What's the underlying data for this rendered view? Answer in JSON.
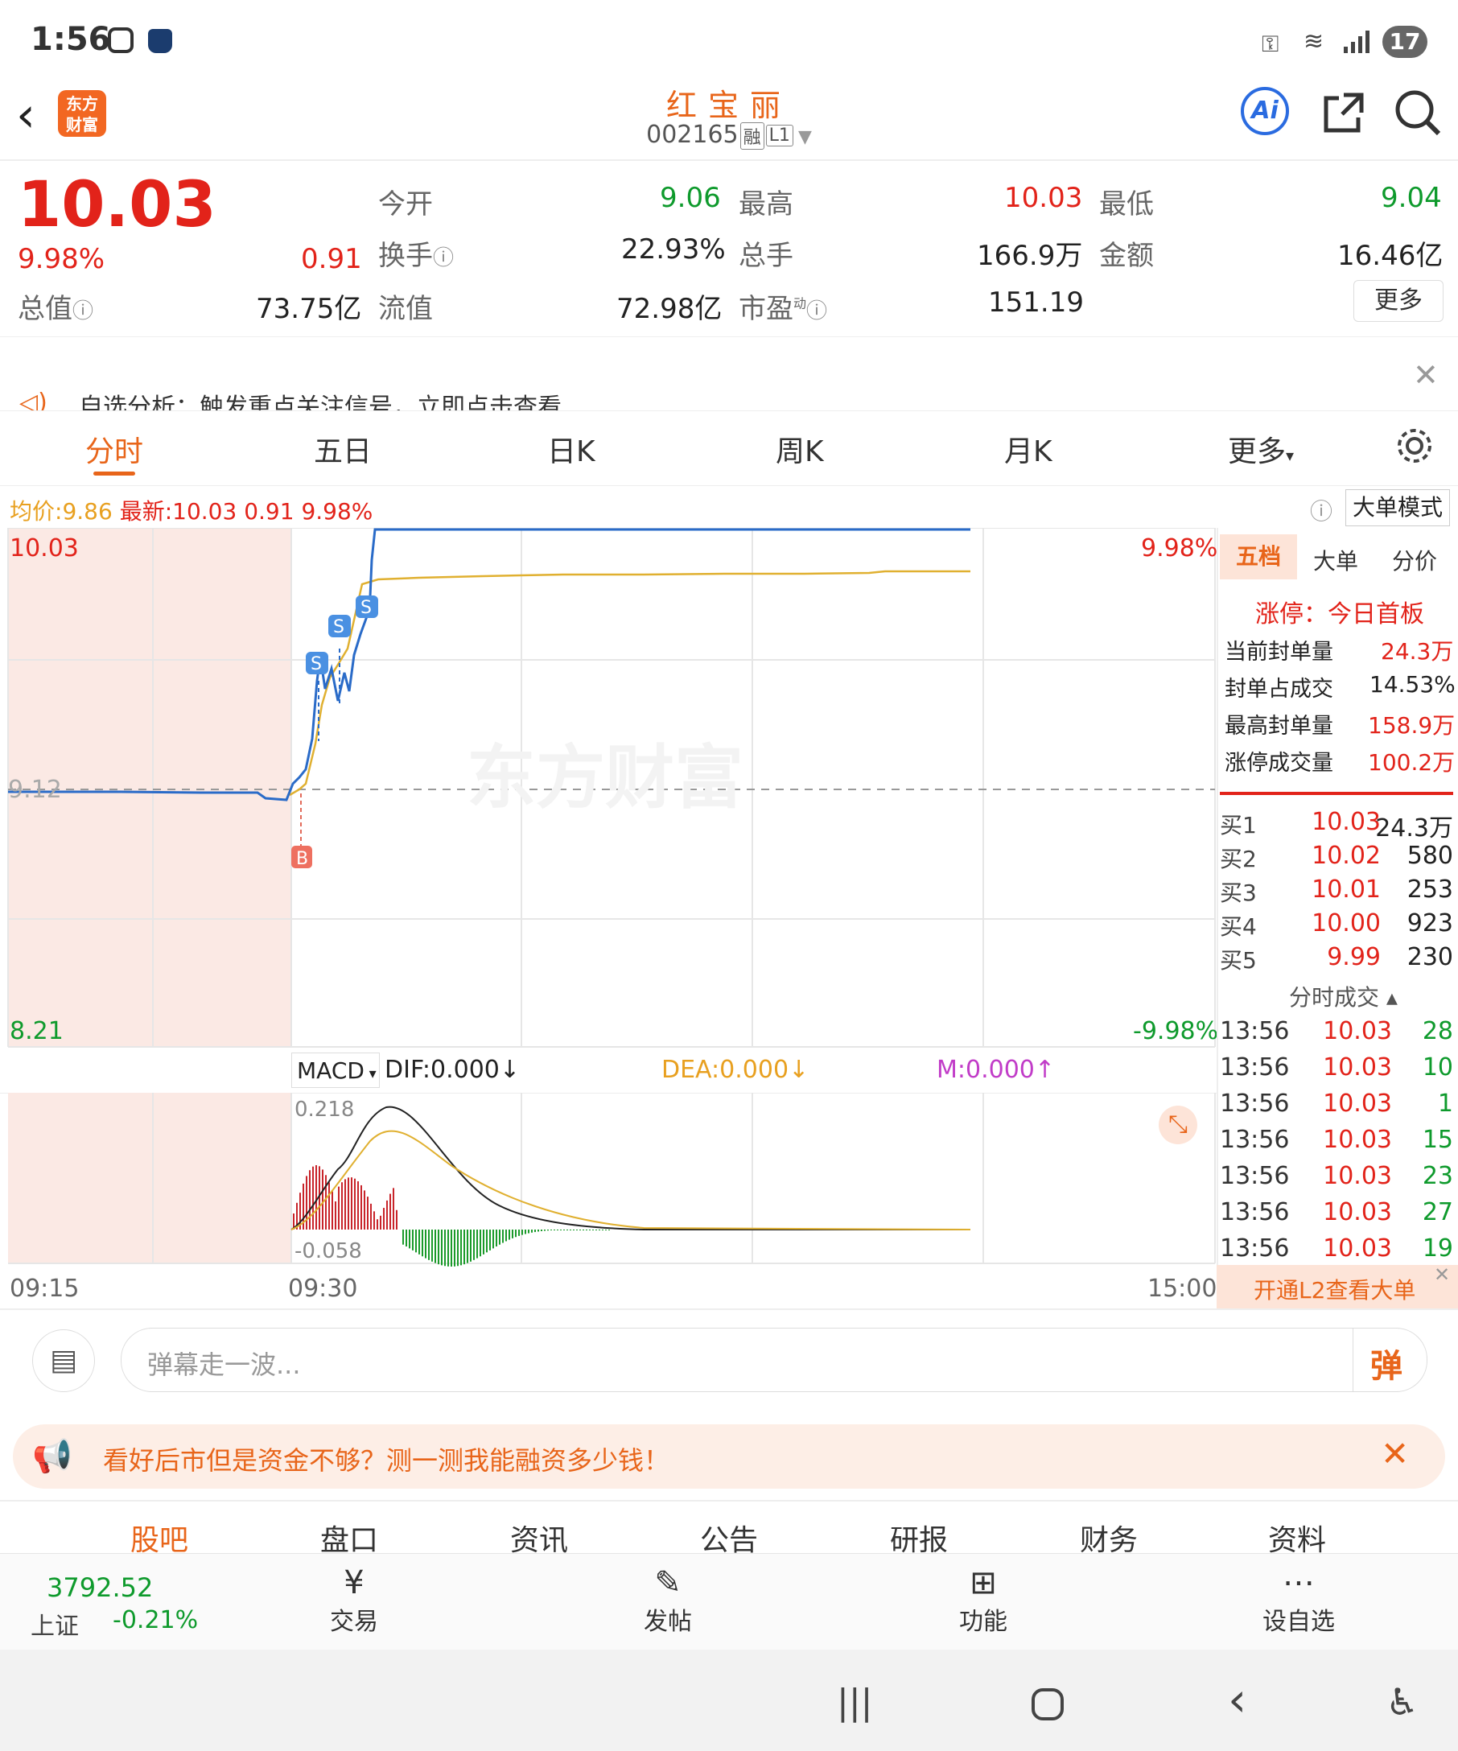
{
  "status_bar": {
    "time": "1:56",
    "battery": "17"
  },
  "header": {
    "title": "红宝丽",
    "code": "002165",
    "tag1": "融",
    "tag2": "L1",
    "ai_label": "Ai",
    "logo_line1": "东方",
    "logo_line2": "财富"
  },
  "quote": {
    "price": "10.03",
    "change_pct": "9.98%",
    "change": "0.91",
    "open_label": "今开",
    "open": "9.06",
    "high_label": "最高",
    "high": "10.03",
    "low_label": "最低",
    "low": "9.04",
    "turnover_label": "换手",
    "turnover": "22.93%",
    "volume_label": "总手",
    "volume": "166.9万",
    "amount_label": "金额",
    "amount": "16.46亿",
    "mktcap_label": "总值",
    "mktcap": "73.75亿",
    "float_label": "流值",
    "float_cap": "72.98亿",
    "pe_label": "市盈",
    "pe_sup": "动",
    "pe": "151.19",
    "more_button": "更多"
  },
  "notice": {
    "text": "自选分析：触发重点关注信号，立即点击查看"
  },
  "tabs": [
    "分时",
    "五日",
    "日K",
    "周K",
    "月K",
    "更多"
  ],
  "info_line": {
    "avg_label": "均价:",
    "avg": "9.86",
    "latest_label": "最新:",
    "latest": "10.03",
    "change": "0.91",
    "pct": "9.98%",
    "mode_button": "大单模式"
  },
  "chart": {
    "price_top": "10.03",
    "price_bottom": "8.21",
    "pct_top": "9.98%",
    "pct_bottom": "-9.98%",
    "prev_close": "9.12",
    "watermark": "东方财富",
    "time_labels": [
      "09:15",
      "09:30",
      "15:00"
    ],
    "marker_b": "B",
    "marker_s": "S",
    "macd_label": "MACD",
    "dif": "DIF:0.000",
    "dea": "DEA:0.000",
    "m": "M:0.000",
    "macd_top": "0.218",
    "macd_bottom": "-0.058"
  },
  "side_tabs": [
    "五档",
    "大单",
    "分价"
  ],
  "limit_info": {
    "title": "涨停：今日首板",
    "rows": [
      {
        "label": "当前封单量",
        "value": "24.3万"
      },
      {
        "label": "封单占成交",
        "value": "14.53%"
      },
      {
        "label": "最高封单量",
        "value": "158.9万"
      },
      {
        "label": "涨停成交量",
        "value": "100.2万"
      }
    ]
  },
  "bids": [
    {
      "label": "买1",
      "price": "10.03",
      "vol": "24.3万"
    },
    {
      "label": "买2",
      "price": "10.02",
      "vol": "580"
    },
    {
      "label": "买3",
      "price": "10.01",
      "vol": "253"
    },
    {
      "label": "买4",
      "price": "10.00",
      "vol": "923"
    },
    {
      "label": "买5",
      "price": "9.99",
      "vol": "230"
    }
  ],
  "trades_title": "分时成交",
  "trades": [
    {
      "time": "13:56",
      "price": "10.03",
      "vol": "28"
    },
    {
      "time": "13:56",
      "price": "10.03",
      "vol": "10"
    },
    {
      "time": "13:56",
      "price": "10.03",
      "vol": "1"
    },
    {
      "time": "13:56",
      "price": "10.03",
      "vol": "15"
    },
    {
      "time": "13:56",
      "price": "10.03",
      "vol": "23"
    },
    {
      "time": "13:56",
      "price": "10.03",
      "vol": "27"
    },
    {
      "time": "13:56",
      "price": "10.03",
      "vol": "19"
    }
  ],
  "l2_banner": "开通L2查看大单",
  "danmaku": {
    "placeholder": "弹幕走一波...",
    "send": "弹"
  },
  "ad": {
    "text": "看好后市但是资金不够？测一测我能融资多少钱！"
  },
  "bottom_tabs": [
    "股吧",
    "盘口",
    "资讯",
    "公告",
    "研报",
    "财务",
    "资料"
  ],
  "index": {
    "value": "3792.52",
    "name": "上证",
    "pct": "-0.21%"
  },
  "actions": [
    "交易",
    "发帖",
    "功能",
    "设自选"
  ]
}
